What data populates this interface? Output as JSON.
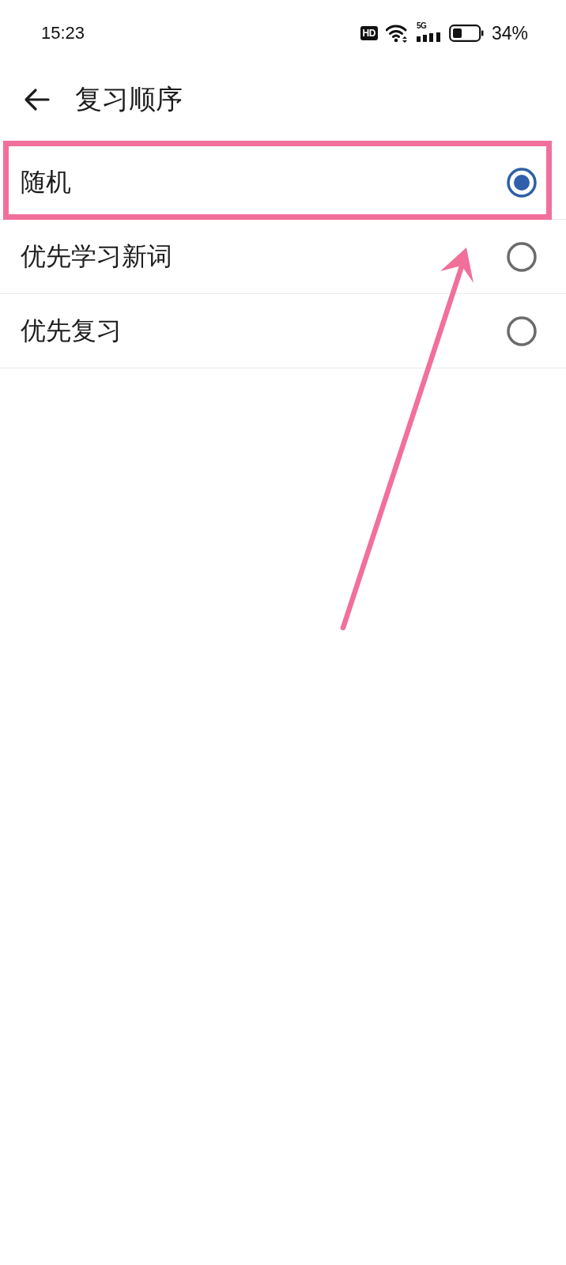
{
  "status_bar": {
    "time": "15:23",
    "hd_badge": "HD",
    "network_type": "5G",
    "battery_percent": "34%"
  },
  "header": {
    "title": "复习顺序"
  },
  "options": [
    {
      "label": "随机",
      "selected": true,
      "highlighted": true
    },
    {
      "label": "优先学习新词",
      "selected": false,
      "highlighted": false
    },
    {
      "label": "优先复习",
      "selected": false,
      "highlighted": false
    }
  ]
}
